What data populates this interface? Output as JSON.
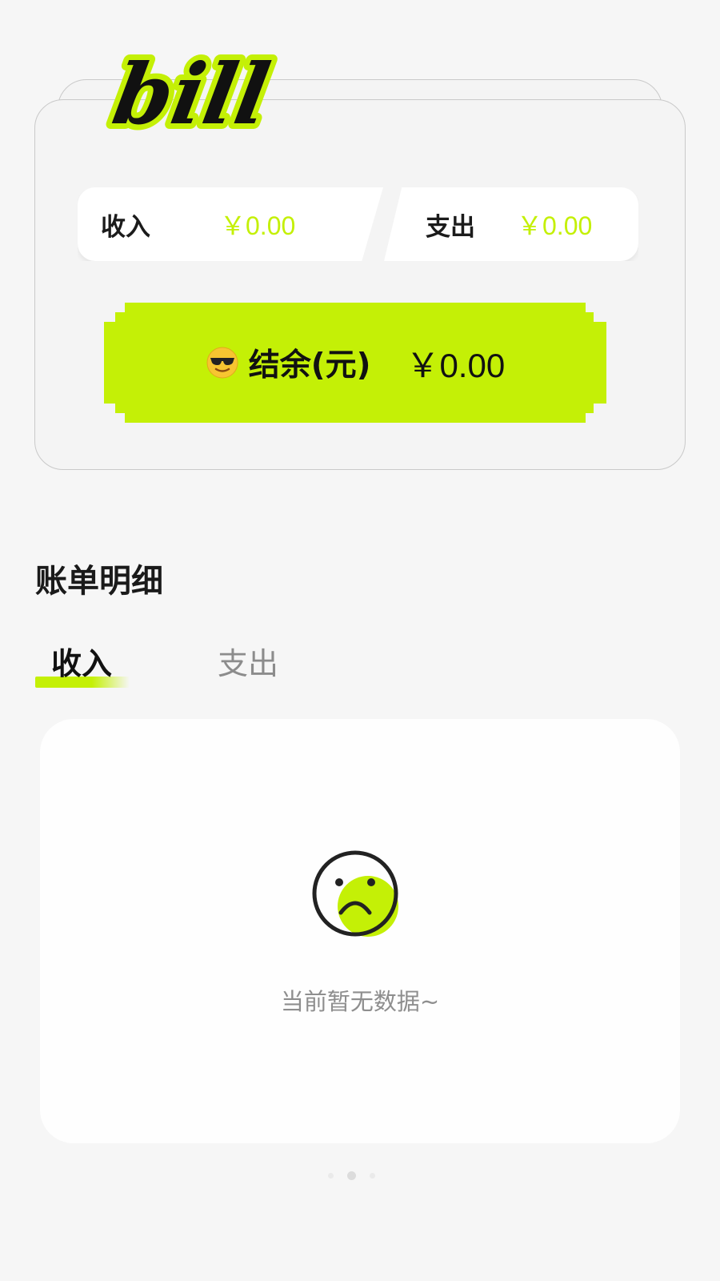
{
  "logo": {
    "text": "bill"
  },
  "summary": {
    "income": {
      "label": "收入",
      "value": "￥0.00"
    },
    "expense": {
      "label": "支出",
      "value": "￥0.00"
    },
    "balance": {
      "icon": "sunglasses-emoji-icon",
      "label": "结余(元)",
      "value": "￥0.00"
    }
  },
  "details": {
    "title": "账单明细",
    "tabs": [
      {
        "label": "收入",
        "active": true
      },
      {
        "label": "支出",
        "active": false
      }
    ],
    "empty": {
      "icon": "sad-face-icon",
      "text": "当前暂无数据~"
    }
  },
  "pager": {
    "count": 3,
    "active_index": 1
  },
  "colors": {
    "accent": "#c4f006",
    "background": "#f6f6f6",
    "card": "#ffffff",
    "text_primary": "#111111",
    "text_muted": "#8e8e8e"
  }
}
